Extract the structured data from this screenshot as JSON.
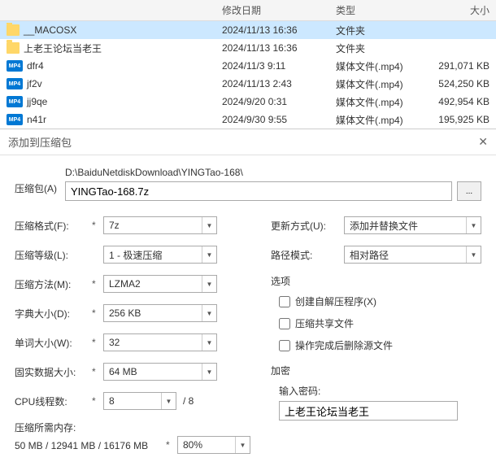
{
  "file_header": {
    "date": "修改日期",
    "type": "类型",
    "size": "大小"
  },
  "files": [
    {
      "icon": "folder",
      "name": "__MACOSX",
      "date": "2024/11/13 16:36",
      "type": "文件夹",
      "size": "",
      "selected": true
    },
    {
      "icon": "folder",
      "name": "上老王论坛当老王",
      "date": "2024/11/13 16:36",
      "type": "文件夹",
      "size": ""
    },
    {
      "icon": "mp4",
      "name": "dfr4",
      "date": "2024/11/3 9:11",
      "type": "媒体文件(.mp4)",
      "size": "291,071 KB"
    },
    {
      "icon": "mp4",
      "name": "jf2v",
      "date": "2024/11/13 2:43",
      "type": "媒体文件(.mp4)",
      "size": "524,250 KB"
    },
    {
      "icon": "mp4",
      "name": "jj9qe",
      "date": "2024/9/20 0:31",
      "type": "媒体文件(.mp4)",
      "size": "492,954 KB"
    },
    {
      "icon": "mp4",
      "name": "n41r",
      "date": "2024/9/30 9:55",
      "type": "媒体文件(.mp4)",
      "size": "195,925 KB"
    }
  ],
  "dialog": {
    "title": "添加到压缩包"
  },
  "archive": {
    "label": "压缩包(A)",
    "dir": "D:\\BaiduNetdiskDownload\\YINGTao-168\\",
    "file": "YINGTao-168.7z",
    "browse": "..."
  },
  "left": {
    "format_label": "压缩格式(F):",
    "format_value": "7z",
    "level_label": "压缩等级(L):",
    "level_value": "1 - 极速压缩",
    "method_label": "压缩方法(M):",
    "method_value": "LZMA2",
    "dict_label": "字典大小(D):",
    "dict_value": "256 KB",
    "word_label": "单词大小(W):",
    "word_value": "32",
    "solid_label": "固实数据大小:",
    "solid_value": "64 MB",
    "cpu_label": "CPU线程数:",
    "cpu_value": "8",
    "cpu_total": "/ 8",
    "mem_label": "压缩所需内存:",
    "mem_info": "50 MB / 12941 MB / 16176 MB",
    "mem_combo": "80%"
  },
  "right": {
    "update_label": "更新方式(U):",
    "update_value": "添加并替换文件",
    "path_label": "路径模式:",
    "path_value": "相对路径",
    "options_title": "选项",
    "sfx_label": "创建自解压程序(X)",
    "share_label": "压缩共享文件",
    "delete_label": "操作完成后删除源文件",
    "encrypt_title": "加密",
    "pwd_label": "输入密码:",
    "pwd_value": "上老王论坛当老王"
  }
}
